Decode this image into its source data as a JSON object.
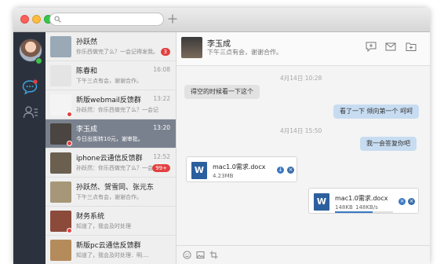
{
  "search": {
    "placeholder": ""
  },
  "sidebar": {
    "nav": [
      {
        "name": "chat",
        "active": true
      },
      {
        "name": "contacts",
        "active": false
      }
    ]
  },
  "conversations": [
    {
      "name": "孙跃然",
      "preview": "你乐西做完了么？一会记得发我。",
      "time": "",
      "badge": "3",
      "avatar_color": "#9aa9b6"
    },
    {
      "name": "陈春和",
      "preview": "下午三点有会，谢谢合作。",
      "time": "16:08",
      "badge": "",
      "avatar_color": "#e4e4e4"
    },
    {
      "name": "新版webmail反馈群",
      "preview": "孙跃然：你乐西做完了么？一会记",
      "time": "13:22",
      "badge": "",
      "avatar_color": "#f4f4f4"
    },
    {
      "name": "李玉成",
      "preview": "今日出街转10元，谢审批。",
      "time": "13:20",
      "badge": "",
      "avatar_color": "#4a4540",
      "active": true
    },
    {
      "name": "iphone云通信反馈群",
      "preview": "孙跃然：你乐西做完了么？一会",
      "time": "12:52",
      "badge": "99+",
      "avatar_color": "#6b6050"
    },
    {
      "name": "孙跃然、贺雪同、张元东",
      "preview": "下午三点有会，谢谢合作。",
      "time": "",
      "badge": "",
      "avatar_color": "#a59778"
    },
    {
      "name": "财务系统",
      "preview": "知道了，我会及时处理",
      "time": "",
      "badge": "",
      "avatar_color": "#8c4a3a"
    },
    {
      "name": "新版pc云通信反馈群",
      "preview": "知道了，我会及时处理．明....",
      "time": "",
      "badge": "",
      "avatar_color": "#b48c5c"
    }
  ],
  "chat": {
    "peer_name": "李玉成",
    "peer_status": "下午三点有会，谢谢合作。",
    "messages": [
      {
        "kind": "stamp",
        "text": "4月14日  10:28"
      },
      {
        "kind": "in",
        "text": "得空的时候看一下这个"
      },
      {
        "kind": "out",
        "text": "看了一下 倾向第一个 呵呵"
      },
      {
        "kind": "stamp",
        "text": "4月14日  15:50"
      },
      {
        "kind": "out",
        "text": "我一会答复你吧"
      }
    ],
    "files": [
      {
        "icon_letter": "W",
        "name": "mac1.0需求.docx",
        "size": "4.23MB",
        "direction": "in"
      },
      {
        "icon_letter": "W",
        "name": "mac1.0需求.docx",
        "progress_text": "148KB",
        "speed_text": "148KB/s",
        "progress": 0.65,
        "direction": "out"
      }
    ]
  },
  "colors": {
    "nav_bg": "#2c323d",
    "accent_red": "#e2403f",
    "outgoing_bubble": "#c7dcf1",
    "file_icon": "#2c5f9e"
  }
}
